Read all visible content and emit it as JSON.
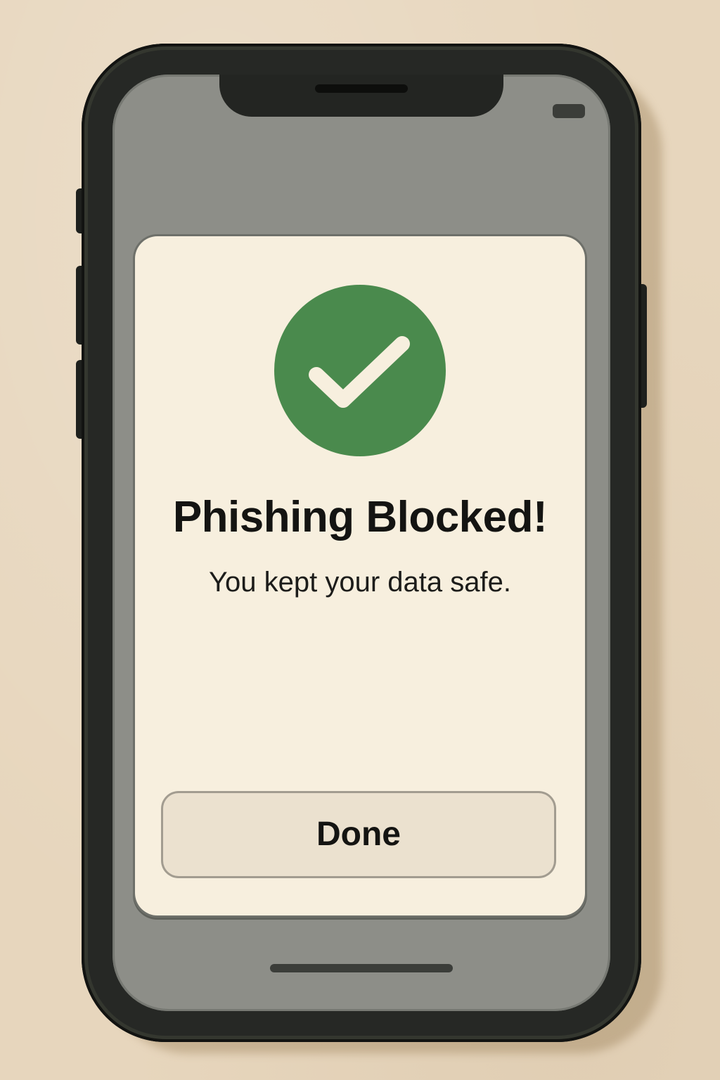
{
  "dialog": {
    "icon": "checkmark-circle-icon",
    "title": "Phishing Blocked!",
    "message": "You kept your data safe.",
    "done_label": "Done"
  },
  "status_bar": {
    "icon": "battery-icon"
  },
  "colors": {
    "background": "#e7d6bd",
    "phone_frame": "#262825",
    "screen": "#8d8e88",
    "card": "#f7efde",
    "success_green": "#4a8a4d",
    "button": "#ebe1cf"
  }
}
